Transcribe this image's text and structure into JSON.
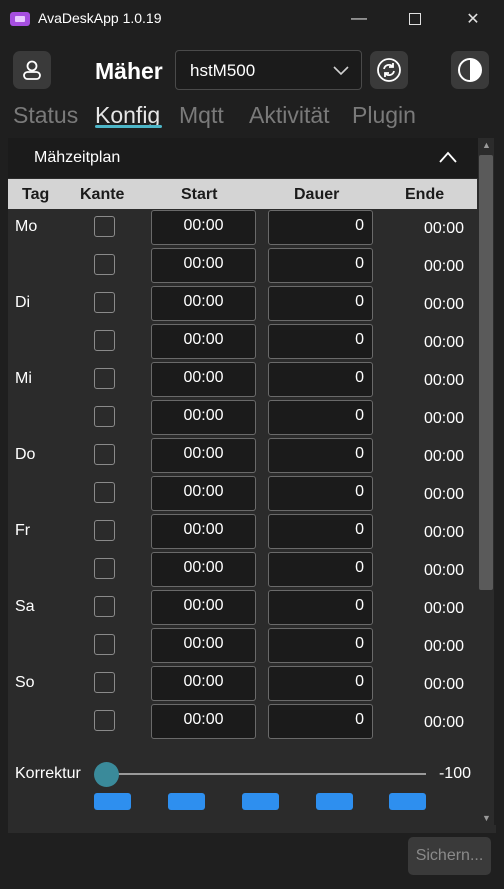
{
  "window": {
    "title": "AvaDeskApp 1.0.19",
    "minimize_glyph": "—",
    "close_glyph": "✕"
  },
  "header": {
    "maeher_label": "Mäher",
    "device_select": {
      "value": "hstM500"
    },
    "icons": [
      "user-icon",
      "refresh-icon",
      "theme-contrast-icon",
      "chevron-down-icon"
    ]
  },
  "tabs": [
    {
      "label": "Status"
    },
    {
      "label": "Konfig"
    },
    {
      "label": "Mqtt"
    },
    {
      "label": "Aktivität"
    },
    {
      "label": "Plugin"
    }
  ],
  "active_tab": "Konfig",
  "panel": {
    "title": "Mähzeitplan",
    "columns": [
      "Tag",
      "Kante",
      "Start",
      "Dauer",
      "Ende"
    ],
    "rows": [
      {
        "day": "Mo",
        "kante": false,
        "start": "00:00",
        "dauer": "0",
        "ende": "00:00"
      },
      {
        "day": "",
        "kante": false,
        "start": "00:00",
        "dauer": "0",
        "ende": "00:00"
      },
      {
        "day": "Di",
        "kante": false,
        "start": "00:00",
        "dauer": "0",
        "ende": "00:00"
      },
      {
        "day": "",
        "kante": false,
        "start": "00:00",
        "dauer": "0",
        "ende": "00:00"
      },
      {
        "day": "Mi",
        "kante": false,
        "start": "00:00",
        "dauer": "0",
        "ende": "00:00"
      },
      {
        "day": "",
        "kante": false,
        "start": "00:00",
        "dauer": "0",
        "ende": "00:00"
      },
      {
        "day": "Do",
        "kante": false,
        "start": "00:00",
        "dauer": "0",
        "ende": "00:00"
      },
      {
        "day": "",
        "kante": false,
        "start": "00:00",
        "dauer": "0",
        "ende": "00:00"
      },
      {
        "day": "Fr",
        "kante": false,
        "start": "00:00",
        "dauer": "0",
        "ende": "00:00"
      },
      {
        "day": "",
        "kante": false,
        "start": "00:00",
        "dauer": "0",
        "ende": "00:00"
      },
      {
        "day": "Sa",
        "kante": false,
        "start": "00:00",
        "dauer": "0",
        "ende": "00:00"
      },
      {
        "day": "",
        "kante": false,
        "start": "00:00",
        "dauer": "0",
        "ende": "00:00"
      },
      {
        "day": "So",
        "kante": false,
        "start": "00:00",
        "dauer": "0",
        "ende": "00:00"
      },
      {
        "day": "",
        "kante": false,
        "start": "00:00",
        "dauer": "0",
        "ende": "00:00"
      }
    ],
    "korrektur": {
      "label": "Korrektur",
      "value": "-100",
      "slider_fraction": 0
    },
    "preset_buttons": 5
  },
  "save_button": {
    "label": "Sichern..."
  },
  "colors": {
    "background": "#1f1f1f",
    "panel": "#2b2b2b",
    "accent": "#4db6c8",
    "preset_blue": "#2e8fef",
    "header_row": "#d4d4d4"
  }
}
